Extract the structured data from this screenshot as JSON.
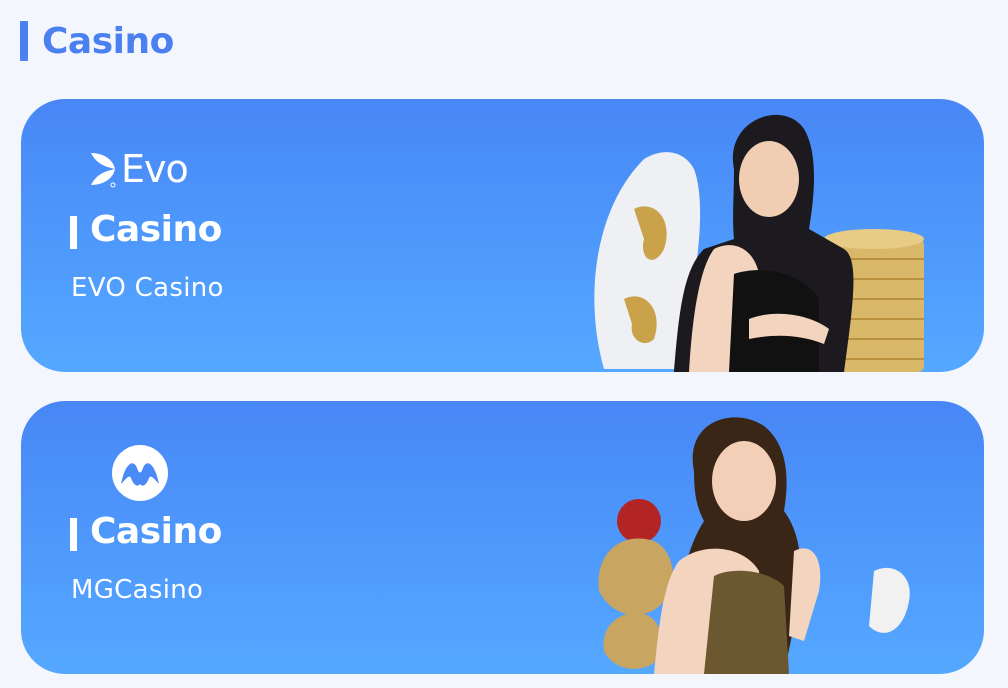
{
  "section": {
    "title": "Casino"
  },
  "cards": [
    {
      "provider_logo": "evo-logo",
      "logo_text": "Evo",
      "subtitle": "Casino",
      "description": "EVO Casino"
    },
    {
      "provider_logo": "microgaming-logo",
      "subtitle": "Casino",
      "description": "MGCasino"
    }
  ],
  "colors": {
    "accent": "#4a80f0",
    "card_top": "#4887f5",
    "card_bottom": "#55a8ff",
    "background": "#f4f6fd"
  }
}
